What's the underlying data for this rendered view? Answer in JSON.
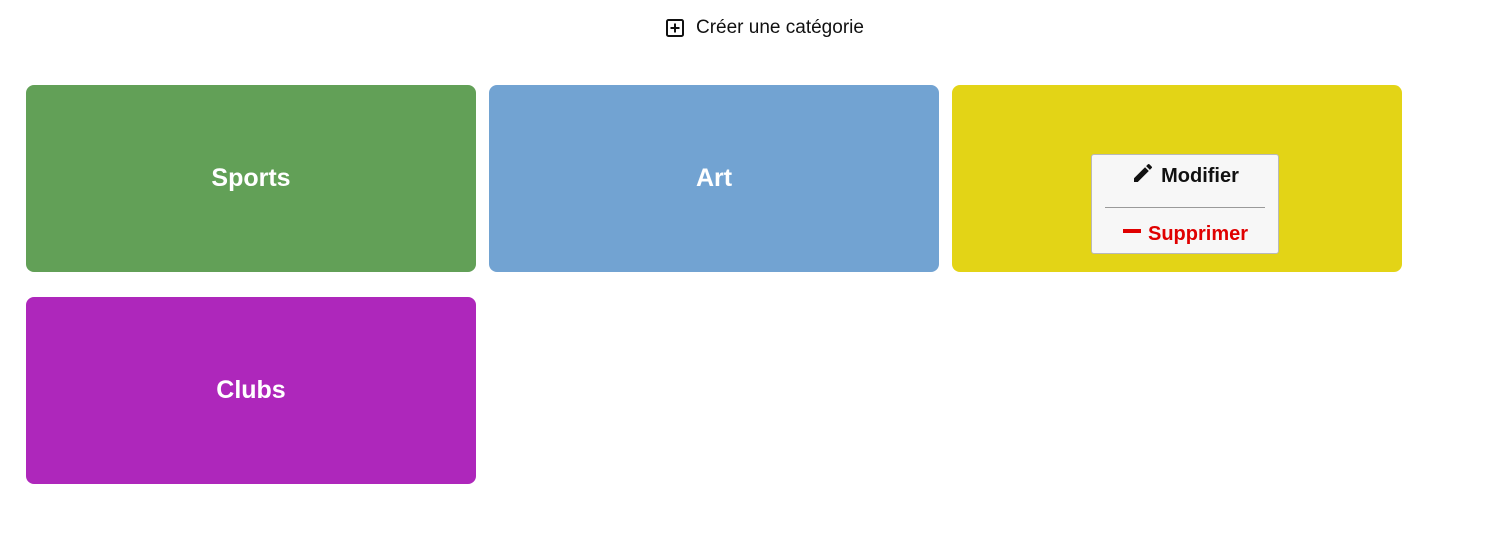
{
  "toolbar": {
    "create_label": "Créer une catégorie",
    "create_icon": "plus-square-icon"
  },
  "categories": [
    {
      "name": "Sports",
      "color": "#62a057"
    },
    {
      "name": "Art",
      "color": "#72a3d2"
    },
    {
      "name": "",
      "color": "#e3d416"
    },
    {
      "name": "Clubs",
      "color": "#ae27bb"
    }
  ],
  "context_menu": {
    "edit_label": "Modifier",
    "edit_icon": "pencil-icon",
    "delete_label": "Supprimer",
    "delete_icon": "minus-icon",
    "delete_color": "#e00000"
  }
}
